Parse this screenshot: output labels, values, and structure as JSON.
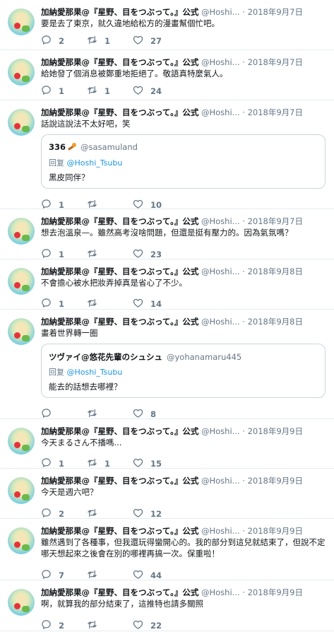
{
  "author": {
    "name": "加納愛那果@『星野、目をつぶって。』公式",
    "handle": "@Hoshi...",
    "dot": "·"
  },
  "tweets": [
    {
      "date": "2018年9月7日",
      "text": "要是去了東京，就久違地給松方的漫畫幫個忙吧。",
      "replies": "2",
      "retweets": "1",
      "likes": "27"
    },
    {
      "date": "2018年9月7日",
      "text": "給她發了個消息被鄭重地拒絕了。敬語真特麼氣人。",
      "replies": "1",
      "retweets": "1",
      "likes": "24"
    },
    {
      "date": "2018年9月7日",
      "text": "話說這說法不太好吧，笑",
      "replies": "1",
      "retweets": "",
      "likes": "10",
      "quote": {
        "name": "336",
        "handle": "@sasamuland",
        "reply_prefix": "回复",
        "reply_to": "@Hoshi_Tsubu",
        "text": "黑皮同伴？"
      }
    },
    {
      "date": "2018年9月7日",
      "text": "想去泡溫泉—。雖然高考沒啥問題，但還是挺有壓力的。因為氣氛嗎？",
      "replies": "1",
      "retweets": "",
      "likes": "23"
    },
    {
      "date": "2018年9月8日",
      "text": "不會擔心被水把妝弄掉真是省心了不少。",
      "replies": "1",
      "retweets": "",
      "likes": "14"
    },
    {
      "date": "2018年9月8日",
      "text": "畫着世界轉一圈",
      "replies": "",
      "retweets": "",
      "likes": "8",
      "quote": {
        "name": "ツヴァイ@悠花先輩のシュシュ",
        "handle": "@yohanamaru445",
        "reply_prefix": "回复",
        "reply_to": "@Hoshi_Tsubu",
        "text": "能去的話想去哪裡？"
      }
    },
    {
      "date": "2018年9月9日",
      "text": "今天まるさん不播嗎...",
      "replies": "1",
      "retweets": "1",
      "likes": "15"
    },
    {
      "date": "2018年9月9日",
      "text": "今天是週六吧？",
      "replies": "2",
      "retweets": "",
      "likes": "12"
    },
    {
      "date": "2018年9月9日",
      "text": "雖然遇到了各種事，但我還玩得蠻開心的。我的部分到這兒就結束了，但說不定哪天想起來之後會在別的哪裡再搞一次。保重啦！",
      "replies": "7",
      "retweets": "",
      "likes": "44"
    },
    {
      "date": "2018年9月9日",
      "text": "啊，就算我的部分結束了，這推特也請多關照",
      "replies": "2",
      "retweets": "",
      "likes": "22"
    }
  ],
  "icons": {
    "reply": "speech-bubble-icon",
    "retweet": "retweet-arrows-icon",
    "like": "heart-icon"
  },
  "colors": {
    "text": "#14171a",
    "muted": "#657786",
    "border": "#e6ecf0",
    "link": "#1b95e0"
  }
}
